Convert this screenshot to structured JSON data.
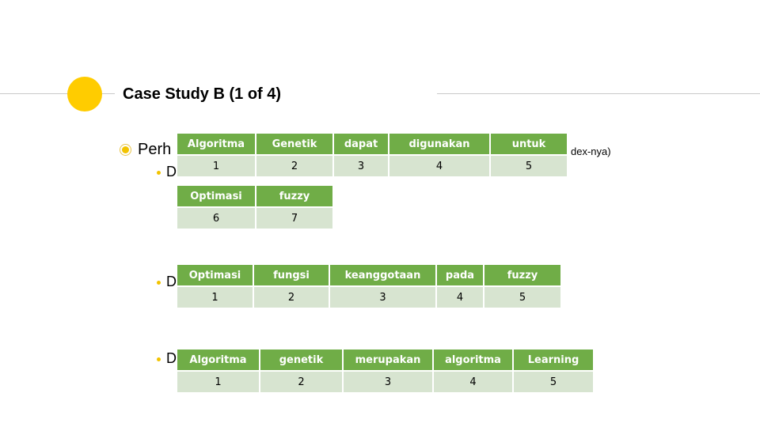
{
  "slide": {
    "title": "Case Study B (1 of 4)",
    "bullet_level1": "Perh",
    "bullet_level1_suffix": "dex-nya)",
    "bullet_level2_prefix": "D"
  },
  "colors": {
    "accent_circle": "#ffcc00",
    "table_header": "#70ad47",
    "table_index_row": "#d7e4d0"
  },
  "tables": [
    {
      "words": [
        "Algoritma",
        "Genetik",
        "dapat",
        "digunakan",
        "untuk"
      ],
      "indices": [
        "1",
        "2",
        "3",
        "4",
        "5"
      ]
    },
    {
      "words": [
        "Optimasi",
        "fuzzy"
      ],
      "indices": [
        "6",
        "7"
      ]
    },
    {
      "words": [
        "Optimasi",
        "fungsi",
        "keanggotaan",
        "pada",
        "fuzzy"
      ],
      "indices": [
        "1",
        "2",
        "3",
        "4",
        "5"
      ]
    },
    {
      "words": [
        "Algoritma",
        "genetik",
        "merupakan",
        "algoritma",
        "Learning"
      ],
      "indices": [
        "1",
        "2",
        "3",
        "4",
        "5"
      ]
    }
  ]
}
